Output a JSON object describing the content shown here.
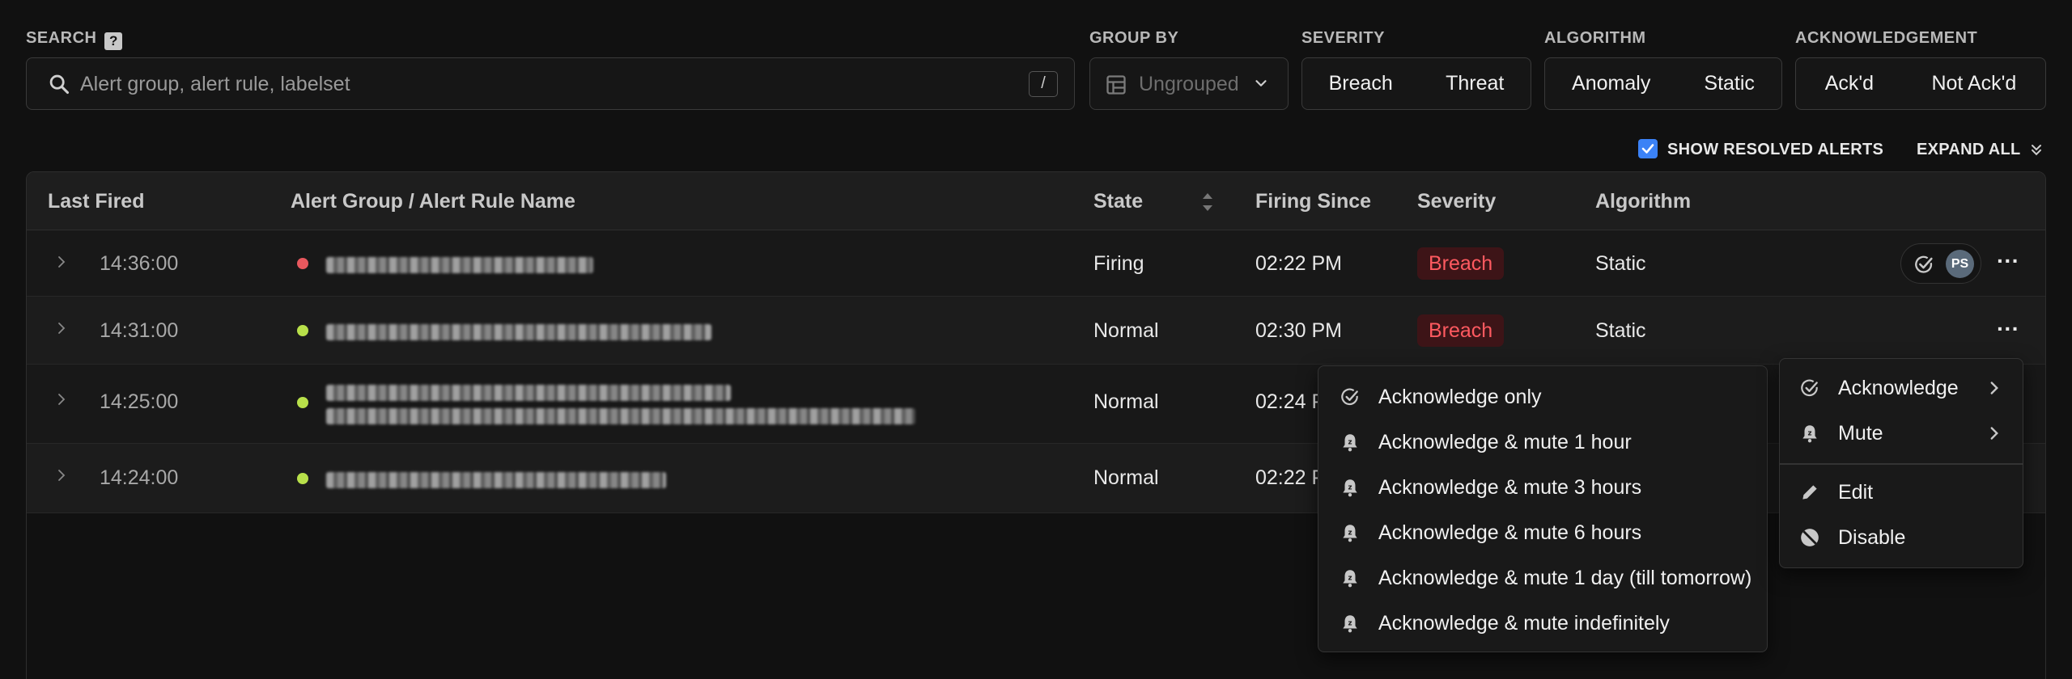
{
  "filters": {
    "search_label": "SEARCH",
    "search_help": "?",
    "search_placeholder": "Alert group, alert rule, labelset",
    "search_shortcut": "/",
    "group_by_label": "GROUP BY",
    "group_by_value": "Ungrouped",
    "severity_label": "SEVERITY",
    "severity_options": [
      "Breach",
      "Threat"
    ],
    "algorithm_label": "ALGORITHM",
    "algorithm_options": [
      "Anomaly",
      "Static"
    ],
    "ack_label": "ACKNOWLEDGEMENT",
    "ack_options": [
      "Ack'd",
      "Not Ack'd"
    ]
  },
  "toolbar": {
    "show_resolved_label": "SHOW RESOLVED ALERTS",
    "show_resolved_checked": true,
    "expand_all_label": "EXPAND ALL"
  },
  "table": {
    "columns": [
      "Last Fired",
      "Alert Group / Alert Rule Name",
      "State",
      "Firing Since",
      "Severity",
      "Algorithm"
    ],
    "rows": [
      {
        "last_fired": "14:36:00",
        "state": "Firing",
        "firing_since": "02:22 PM",
        "severity": "Breach",
        "algorithm": "Static",
        "dot_color": "#e8585e",
        "avatar": "PS"
      },
      {
        "last_fired": "14:31:00",
        "state": "Normal",
        "firing_since": "02:30 PM",
        "severity": "Breach",
        "algorithm": "Static",
        "dot_color": "#b8e04a"
      },
      {
        "last_fired": "14:25:00",
        "state": "Normal",
        "firing_since": "02:24 PM",
        "dot_color": "#b8e04a"
      },
      {
        "last_fired": "14:24:00",
        "state": "Normal",
        "firing_since": "02:22 PM",
        "dot_color": "#b8e04a"
      }
    ]
  },
  "context_menu": {
    "acknowledge": "Acknowledge",
    "mute": "Mute",
    "edit": "Edit",
    "disable": "Disable"
  },
  "submenu": {
    "items": [
      "Acknowledge only",
      "Acknowledge & mute 1 hour",
      "Acknowledge & mute 3 hours",
      "Acknowledge & mute 6 hours",
      "Acknowledge & mute 1 day (till tomorrow)",
      "Acknowledge & mute indefinitely"
    ]
  },
  "colors": {
    "breach_bg": "#3d1417",
    "breach_text": "#ff5a60",
    "checkbox": "#3b82f6",
    "firing_dot": "#e8585e",
    "normal_dot": "#b8e04a"
  }
}
